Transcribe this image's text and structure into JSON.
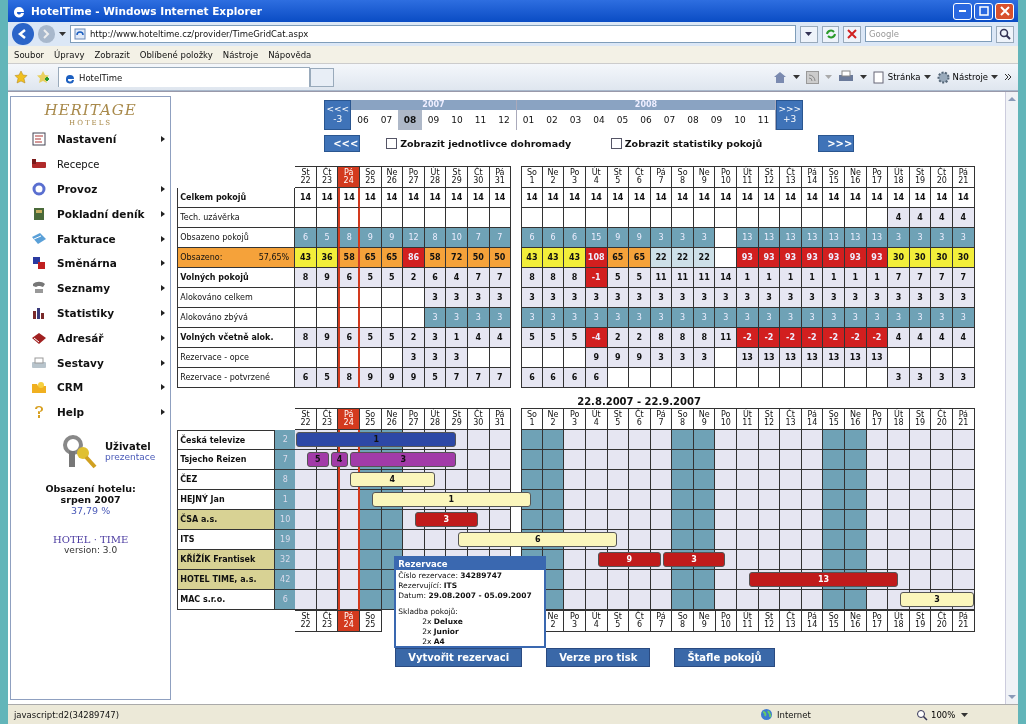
{
  "window": {
    "title": "HotelTime - Windows Internet Explorer"
  },
  "address_bar": {
    "url": "http://www.hoteltime.cz/provider/TimeGridCat.aspx",
    "search_placeholder": "Google"
  },
  "menu": [
    "Soubor",
    "Úpravy",
    "Zobrazit",
    "Oblíbené položky",
    "Nástroje",
    "Nápověda"
  ],
  "tabs": [
    {
      "label": "HotelTime",
      "selected": true
    }
  ],
  "command_bar": [
    "Stránka",
    "Nástroje"
  ],
  "sidebar": {
    "logo": "HERITAGE",
    "logo_sub": "HOTELS",
    "items": [
      {
        "label": "Nastavení",
        "has_submenu": true
      },
      {
        "label": "Recepce",
        "has_submenu": false
      },
      {
        "label": "Provoz",
        "has_submenu": true
      },
      {
        "label": "Pokladní deník",
        "has_submenu": true
      },
      {
        "label": "Fakturace",
        "has_submenu": true
      },
      {
        "label": "Směnárna",
        "has_submenu": true
      },
      {
        "label": "Seznamy",
        "has_submenu": true
      },
      {
        "label": "Statistiky",
        "has_submenu": true
      },
      {
        "label": "Adresář",
        "has_submenu": true
      },
      {
        "label": "Sestavy",
        "has_submenu": true
      },
      {
        "label": "CRM",
        "has_submenu": true
      },
      {
        "label": "Help",
        "has_submenu": true
      }
    ],
    "user": {
      "label": "Uživatel",
      "name": "prezentace"
    },
    "occupancy": {
      "label": "Obsazení hotelu:",
      "period": "srpen 2007",
      "value": "37,79 %"
    },
    "brand": "HOTEL · TIME",
    "version": "version: 3.0"
  },
  "period_nav": {
    "back": "<<<",
    "back_step": "-3",
    "forward": ">>>",
    "forward_step": "+3",
    "years": [
      {
        "label": "2007",
        "months": [
          {
            "label": "06",
            "selected": false
          },
          {
            "label": "07",
            "selected": false
          },
          {
            "label": "08",
            "selected": true
          },
          {
            "label": "09",
            "selected": false
          },
          {
            "label": "10",
            "selected": false
          },
          {
            "label": "11",
            "selected": false
          },
          {
            "label": "12",
            "selected": false
          }
        ]
      },
      {
        "label": "2008",
        "months": [
          {
            "label": "01",
            "selected": false
          },
          {
            "label": "02",
            "selected": false
          },
          {
            "label": "03",
            "selected": false
          },
          {
            "label": "04",
            "selected": false
          },
          {
            "label": "05",
            "selected": false
          },
          {
            "label": "06",
            "selected": false
          },
          {
            "label": "07",
            "selected": false
          },
          {
            "label": "08",
            "selected": false
          },
          {
            "label": "09",
            "selected": false
          },
          {
            "label": "10",
            "selected": false
          },
          {
            "label": "11",
            "selected": false
          }
        ]
      }
    ],
    "prev": "<<<",
    "next": ">>>",
    "options": [
      {
        "label": "Zobrazit jednotlivce dohromady",
        "checked": false
      },
      {
        "label": "Zobrazit statistiky pokojů",
        "checked": false
      }
    ]
  },
  "stats_grid": {
    "days": [
      {
        "weekday": "St",
        "date": "22",
        "selected": false
      },
      {
        "weekday": "Čt",
        "date": "23",
        "selected": false
      },
      {
        "weekday": "Pá",
        "date": "24",
        "selected": true
      },
      {
        "weekday": "So",
        "date": "25",
        "selected": false
      },
      {
        "weekday": "Ne",
        "date": "26",
        "selected": false
      },
      {
        "weekday": "Po",
        "date": "27",
        "selected": false
      },
      {
        "weekday": "Út",
        "date": "28",
        "selected": false
      },
      {
        "weekday": "St",
        "date": "29",
        "selected": false
      },
      {
        "weekday": "Čt",
        "date": "30",
        "selected": false
      },
      {
        "weekday": "Pá",
        "date": "31",
        "selected": false
      },
      {
        "weekday": "So",
        "date": "1",
        "selected": false
      },
      {
        "weekday": "Ne",
        "date": "2",
        "selected": false
      },
      {
        "weekday": "Po",
        "date": "3",
        "selected": false
      },
      {
        "weekday": "Út",
        "date": "4",
        "selected": false
      },
      {
        "weekday": "St",
        "date": "5",
        "selected": false
      },
      {
        "weekday": "Čt",
        "date": "6",
        "selected": false
      },
      {
        "weekday": "Pá",
        "date": "7",
        "selected": false
      },
      {
        "weekday": "So",
        "date": "8",
        "selected": false
      },
      {
        "weekday": "Ne",
        "date": "9",
        "selected": false
      },
      {
        "weekday": "Po",
        "date": "10",
        "selected": false
      },
      {
        "weekday": "Út",
        "date": "11",
        "selected": false
      },
      {
        "weekday": "St",
        "date": "12",
        "selected": false
      },
      {
        "weekday": "Čt",
        "date": "13",
        "selected": false
      },
      {
        "weekday": "Pá",
        "date": "14",
        "selected": false
      },
      {
        "weekday": "So",
        "date": "15",
        "selected": false
      },
      {
        "weekday": "Ne",
        "date": "16",
        "selected": false
      },
      {
        "weekday": "Po",
        "date": "17",
        "selected": false
      },
      {
        "weekday": "Út",
        "date": "18",
        "selected": false
      },
      {
        "weekday": "St",
        "date": "19",
        "selected": false
      },
      {
        "weekday": "Čt",
        "date": "20",
        "selected": false
      },
      {
        "weekday": "Pá",
        "date": "21",
        "selected": false
      }
    ],
    "rows": [
      {
        "label": "Celkem pokojů",
        "bold": true,
        "label_highlighted": false,
        "color": "#ffffff",
        "cells": [
          "14",
          "14",
          "14",
          "14",
          "14",
          "14",
          "14",
          "14",
          "14",
          "14",
          "14",
          "14",
          "14",
          "14",
          "14",
          "14",
          "14",
          "14",
          "14",
          "14",
          "14",
          "14",
          "14",
          "14",
          "14",
          "14",
          "14",
          "14",
          "14",
          "14",
          "14"
        ]
      },
      {
        "label": "Tech. uzávěrka",
        "bold": false,
        "label_highlighted": false,
        "color": "#e6e6f2",
        "cells": [
          null,
          null,
          null,
          null,
          null,
          null,
          null,
          null,
          null,
          null,
          null,
          null,
          null,
          null,
          null,
          null,
          null,
          null,
          null,
          null,
          null,
          null,
          null,
          null,
          null,
          null,
          null,
          "4",
          "4",
          "4",
          "4"
        ]
      },
      {
        "label": "Obsazeno pokojů",
        "bold": false,
        "label_highlighted": false,
        "color": "#6fa2b6",
        "cells": [
          "6",
          "5",
          "8",
          "9",
          "9",
          "12",
          "8",
          "10",
          "7",
          "7",
          "6",
          "6",
          "6",
          "15",
          "9",
          "9",
          "3",
          "3",
          "3",
          null,
          "13",
          "13",
          "13",
          "13",
          "13",
          "13",
          "13",
          "3",
          "3",
          "3",
          "3"
        ]
      },
      {
        "label": "Obsazeno:",
        "value": "57,65%",
        "bold": false,
        "label_highlighted": true,
        "cells": [
          {
            "text": "43",
            "color": "#f2ee3a"
          },
          {
            "text": "36",
            "color": "#f2ee3a"
          },
          {
            "text": "58",
            "color": "#f5a23a"
          },
          {
            "text": "65",
            "color": "#f5a23a"
          },
          {
            "text": "65",
            "color": "#f5a23a"
          },
          {
            "text": "86",
            "color": "#d21f1f"
          },
          {
            "text": "58",
            "color": "#f5a23a"
          },
          {
            "text": "72",
            "color": "#f5a23a"
          },
          {
            "text": "50",
            "color": "#f5a23a"
          },
          {
            "text": "50",
            "color": "#f5a23a"
          },
          {
            "text": "43",
            "color": "#f2ee3a"
          },
          {
            "text": "43",
            "color": "#f2ee3a"
          },
          {
            "text": "43",
            "color": "#f2ee3a"
          },
          {
            "text": "108",
            "color": "#d21f1f"
          },
          {
            "text": "65",
            "color": "#f5a23a"
          },
          {
            "text": "65",
            "color": "#f5a23a"
          },
          {
            "text": "22",
            "color": "#cde0e8"
          },
          {
            "text": "22",
            "color": "#cde0e8"
          },
          {
            "text": "22",
            "color": "#cde0e8"
          },
          null,
          {
            "text": "93",
            "color": "#d21f1f"
          },
          {
            "text": "93",
            "color": "#d21f1f"
          },
          {
            "text": "93",
            "color": "#d21f1f"
          },
          {
            "text": "93",
            "color": "#d21f1f"
          },
          {
            "text": "93",
            "color": "#d21f1f"
          },
          {
            "text": "93",
            "color": "#d21f1f"
          },
          {
            "text": "93",
            "color": "#d21f1f"
          },
          {
            "text": "30",
            "color": "#f2ee3a"
          },
          {
            "text": "30",
            "color": "#f2ee3a"
          },
          {
            "text": "30",
            "color": "#f2ee3a"
          },
          {
            "text": "30",
            "color": "#f2ee3a"
          }
        ]
      },
      {
        "label": "Volných pokojů",
        "bold": true,
        "label_highlighted": false,
        "cells": [
          {
            "text": "8",
            "color": "#e6e6f2"
          },
          {
            "text": "9",
            "color": "#e6e6f2"
          },
          {
            "text": "6",
            "color": "#e6e6f2"
          },
          {
            "text": "5",
            "color": "#e6e6f2"
          },
          {
            "text": "5",
            "color": "#e6e6f2"
          },
          {
            "text": "2",
            "color": "#e6e6f2"
          },
          {
            "text": "6",
            "color": "#e6e6f2"
          },
          {
            "text": "4",
            "color": "#e6e6f2"
          },
          {
            "text": "7",
            "color": "#e6e6f2"
          },
          {
            "text": "7",
            "color": "#e6e6f2"
          },
          {
            "text": "8",
            "color": "#e6e6f2"
          },
          {
            "text": "8",
            "color": "#e6e6f2"
          },
          {
            "text": "8",
            "color": "#e6e6f2"
          },
          {
            "text": "-1",
            "color": "#d21f1f"
          },
          {
            "text": "5",
            "color": "#e6e6f2"
          },
          {
            "text": "5",
            "color": "#e6e6f2"
          },
          {
            "text": "11",
            "color": "#e6e6f2"
          },
          {
            "text": "11",
            "color": "#e6e6f2"
          },
          {
            "text": "11",
            "color": "#e6e6f2"
          },
          {
            "text": "14",
            "color": "#e6e6f2"
          },
          {
            "text": "1",
            "color": "#e6e6f2"
          },
          {
            "text": "1",
            "color": "#e6e6f2"
          },
          {
            "text": "1",
            "color": "#e6e6f2"
          },
          {
            "text": "1",
            "color": "#e6e6f2"
          },
          {
            "text": "1",
            "color": "#e6e6f2"
          },
          {
            "text": "1",
            "color": "#e6e6f2"
          },
          {
            "text": "1",
            "color": "#e6e6f2"
          },
          {
            "text": "7",
            "color": "#e6e6f2"
          },
          {
            "text": "7",
            "color": "#e6e6f2"
          },
          {
            "text": "7",
            "color": "#e6e6f2"
          },
          {
            "text": "7",
            "color": "#e6e6f2"
          }
        ]
      },
      {
        "label": "Alokováno celkem",
        "bold": false,
        "label_highlighted": false,
        "color": "#e6e6f2",
        "cells": [
          null,
          null,
          null,
          null,
          null,
          null,
          "3",
          "3",
          "3",
          "3",
          "3",
          "3",
          "3",
          "3",
          "3",
          "3",
          "3",
          "3",
          "3",
          "3",
          "3",
          "3",
          "3",
          "3",
          "3",
          "3",
          "3",
          "3",
          "3",
          "3",
          "3"
        ]
      },
      {
        "label": "Alokováno zbývá",
        "bold": false,
        "label_highlighted": false,
        "color": "#6fa2b6",
        "cells": [
          null,
          null,
          null,
          null,
          null,
          null,
          "3",
          "3",
          "3",
          "3",
          "3",
          "3",
          "3",
          "3",
          "3",
          "3",
          "3",
          "3",
          "3",
          "3",
          "3",
          "3",
          "3",
          "3",
          "3",
          "3",
          "3",
          "3",
          "3",
          "3",
          "3"
        ]
      },
      {
        "label": "Volných včetně alok.",
        "bold": true,
        "label_highlighted": false,
        "cells": [
          {
            "text": "8",
            "color": "#e6e6f2"
          },
          {
            "text": "9",
            "color": "#e6e6f2"
          },
          {
            "text": "6",
            "color": "#e6e6f2"
          },
          {
            "text": "5",
            "color": "#e6e6f2"
          },
          {
            "text": "5",
            "color": "#e6e6f2"
          },
          {
            "text": "2",
            "color": "#e6e6f2"
          },
          {
            "text": "3",
            "color": "#e6e6f2"
          },
          {
            "text": "1",
            "color": "#e6e6f2"
          },
          {
            "text": "4",
            "color": "#e6e6f2"
          },
          {
            "text": "4",
            "color": "#e6e6f2"
          },
          {
            "text": "5",
            "color": "#e6e6f2"
          },
          {
            "text": "5",
            "color": "#e6e6f2"
          },
          {
            "text": "5",
            "color": "#e6e6f2"
          },
          {
            "text": "-4",
            "color": "#d21f1f"
          },
          {
            "text": "2",
            "color": "#e6e6f2"
          },
          {
            "text": "2",
            "color": "#e6e6f2"
          },
          {
            "text": "8",
            "color": "#e6e6f2"
          },
          {
            "text": "8",
            "color": "#e6e6f2"
          },
          {
            "text": "8",
            "color": "#e6e6f2"
          },
          {
            "text": "11",
            "color": "#e6e6f2"
          },
          {
            "text": "-2",
            "color": "#d21f1f"
          },
          {
            "text": "-2",
            "color": "#d21f1f"
          },
          {
            "text": "-2",
            "color": "#d21f1f"
          },
          {
            "text": "-2",
            "color": "#d21f1f"
          },
          {
            "text": "-2",
            "color": "#d21f1f"
          },
          {
            "text": "-2",
            "color": "#d21f1f"
          },
          {
            "text": "-2",
            "color": "#d21f1f"
          },
          {
            "text": "4",
            "color": "#e6e6f2"
          },
          {
            "text": "4",
            "color": "#e6e6f2"
          },
          {
            "text": "4",
            "color": "#e6e6f2"
          },
          {
            "text": "4",
            "color": "#e6e6f2"
          }
        ]
      },
      {
        "label": "Rezervace - opce",
        "bold": false,
        "label_highlighted": false,
        "color": "#e6e6f2",
        "cells": [
          null,
          null,
          null,
          null,
          null,
          "3",
          "3",
          "3",
          null,
          null,
          null,
          null,
          null,
          "9",
          "9",
          "9",
          "3",
          "3",
          "3",
          null,
          "13",
          "13",
          "13",
          "13",
          "13",
          "13",
          "13",
          null,
          null,
          null,
          null
        ]
      },
      {
        "label": "Rezervace - potvrzené",
        "bold": false,
        "label_highlighted": false,
        "color": "#e6e6f2",
        "cells": [
          "6",
          "5",
          "8",
          "9",
          "9",
          "9",
          "5",
          "7",
          "7",
          "7",
          "6",
          "6",
          "6",
          "6",
          null,
          null,
          null,
          null,
          null,
          null,
          null,
          null,
          null,
          null,
          null,
          null,
          null,
          "3",
          "3",
          "3",
          "3"
        ]
      }
    ]
  },
  "booking_grid": {
    "range": "22.8.2007 - 22.9.2007",
    "days": [
      {
        "weekday": "St",
        "date": "22",
        "selected": false,
        "weekend": false
      },
      {
        "weekday": "Čt",
        "date": "23",
        "selected": false,
        "weekend": false
      },
      {
        "weekday": "Pá",
        "date": "24",
        "selected": true,
        "weekend": false
      },
      {
        "weekday": "So",
        "date": "25",
        "selected": false,
        "weekend": true
      },
      {
        "weekday": "Ne",
        "date": "26",
        "selected": false,
        "weekend": true
      },
      {
        "weekday": "Po",
        "date": "27",
        "selected": false,
        "weekend": false
      },
      {
        "weekday": "Út",
        "date": "28",
        "selected": false,
        "weekend": false
      },
      {
        "weekday": "St",
        "date": "29",
        "selected": false,
        "weekend": false
      },
      {
        "weekday": "Čt",
        "date": "30",
        "selected": false,
        "weekend": false
      },
      {
        "weekday": "Pá",
        "date": "31",
        "selected": false,
        "weekend": false
      },
      {
        "weekday": "So",
        "date": "1",
        "selected": false,
        "weekend": true
      },
      {
        "weekday": "Ne",
        "date": "2",
        "selected": false,
        "weekend": true
      },
      {
        "weekday": "Po",
        "date": "3",
        "selected": false,
        "weekend": false
      },
      {
        "weekday": "Út",
        "date": "4",
        "selected": false,
        "weekend": false
      },
      {
        "weekday": "St",
        "date": "5",
        "selected": false,
        "weekend": false
      },
      {
        "weekday": "Čt",
        "date": "6",
        "selected": false,
        "weekend": false
      },
      {
        "weekday": "Pá",
        "date": "7",
        "selected": false,
        "weekend": false
      },
      {
        "weekday": "So",
        "date": "8",
        "selected": false,
        "weekend": true
      },
      {
        "weekday": "Ne",
        "date": "9",
        "selected": false,
        "weekend": true
      },
      {
        "weekday": "Po",
        "date": "10",
        "selected": false,
        "weekend": false
      },
      {
        "weekday": "Út",
        "date": "11",
        "selected": false,
        "weekend": false
      },
      {
        "weekday": "St",
        "date": "12",
        "selected": false,
        "weekend": false
      },
      {
        "weekday": "Čt",
        "date": "13",
        "selected": false,
        "weekend": false
      },
      {
        "weekday": "Pá",
        "date": "14",
        "selected": false,
        "weekend": false
      },
      {
        "weekday": "So",
        "date": "15",
        "selected": false,
        "weekend": true
      },
      {
        "weekday": "Ne",
        "date": "16",
        "selected": false,
        "weekend": true
      },
      {
        "weekday": "Po",
        "date": "17",
        "selected": false,
        "weekend": false
      },
      {
        "weekday": "Út",
        "date": "18",
        "selected": false,
        "weekend": false
      },
      {
        "weekday": "St",
        "date": "19",
        "selected": false,
        "weekend": false
      },
      {
        "weekday": "Čt",
        "date": "20",
        "selected": false,
        "weekend": false
      },
      {
        "weekday": "Pá",
        "date": "21",
        "selected": false,
        "weekend": false
      }
    ],
    "rows": [
      {
        "name": "Česká televize",
        "rooms": "2",
        "highlighted": false,
        "bars": [
          {
            "label": "1",
            "color": "#2d48a6"
          }
        ]
      },
      {
        "name": "Tsjecho Reizen",
        "rooms": "7",
        "highlighted": false,
        "bars": [
          {
            "label": "5",
            "color": "#a23ba8"
          },
          {
            "label": "4",
            "color": "#a23ba8"
          },
          {
            "label": "3",
            "color": "#a23ba8"
          }
        ]
      },
      {
        "name": "ČEZ",
        "rooms": "8",
        "highlighted": false,
        "bars": [
          {
            "label": "4",
            "color": "#fbf6bc"
          }
        ]
      },
      {
        "name": "HEJNÝ Jan",
        "rooms": "1",
        "highlighted": false,
        "bars": [
          {
            "label": "1",
            "color": "#fbf6bc"
          }
        ]
      },
      {
        "name": "ČSA a.s.",
        "rooms": "10",
        "highlighted": true,
        "bars": [
          {
            "label": "3",
            "color": "#c01b1b"
          }
        ]
      },
      {
        "name": "ITS",
        "rooms": "19",
        "highlighted": false,
        "bars": [
          {
            "label": "6",
            "color": "#fbf6bc"
          }
        ]
      },
      {
        "name": "KŘÍŽÍK Frantisek",
        "rooms": "32",
        "highlighted": true,
        "bars": [
          {
            "label": "9",
            "color": "#c01b1b"
          },
          {
            "label": "3",
            "color": "#c01b1b"
          }
        ]
      },
      {
        "name": "HOTEL TIME, a.s.",
        "rooms": "42",
        "highlighted": true,
        "bars": [
          {
            "label": "13",
            "color": "#c01b1b"
          }
        ]
      },
      {
        "name": "MAC s.r.o.",
        "rooms": "6",
        "highlighted": false,
        "bars": [
          {
            "label": "3",
            "color": "#fbf6bc"
          }
        ]
      }
    ],
    "footer_days_left": [
      {
        "weekday": "St",
        "date": "22",
        "selected": false
      },
      {
        "weekday": "Čt",
        "date": "23",
        "selected": false
      },
      {
        "weekday": "Pá",
        "date": "24",
        "selected": true
      },
      {
        "weekday": "So",
        "date": "25",
        "selected": false
      }
    ],
    "footer_days_right": [
      {
        "weekday": "Ne",
        "date": "2",
        "selected": false
      },
      {
        "weekday": "Po",
        "date": "3",
        "selected": false
      },
      {
        "weekday": "Út",
        "date": "4",
        "selected": false
      },
      {
        "weekday": "St",
        "date": "5",
        "selected": false
      },
      {
        "weekday": "Čt",
        "date": "6",
        "selected": false
      },
      {
        "weekday": "Pá",
        "date": "7",
        "selected": false
      },
      {
        "weekday": "So",
        "date": "8",
        "selected": false
      },
      {
        "weekday": "Ne",
        "date": "9",
        "selected": false
      },
      {
        "weekday": "Po",
        "date": "10",
        "selected": false
      },
      {
        "weekday": "Út",
        "date": "11",
        "selected": false
      },
      {
        "weekday": "St",
        "date": "12",
        "selected": false
      },
      {
        "weekday": "Čt",
        "date": "13",
        "selected": false
      },
      {
        "weekday": "Pá",
        "date": "14",
        "selected": false
      },
      {
        "weekday": "So",
        "date": "15",
        "selected": false
      },
      {
        "weekday": "Ne",
        "date": "16",
        "selected": false
      },
      {
        "weekday": "Po",
        "date": "17",
        "selected": false
      },
      {
        "weekday": "Út",
        "date": "18",
        "selected": false
      },
      {
        "weekday": "St",
        "date": "19",
        "selected": false
      },
      {
        "weekday": "Čt",
        "date": "20",
        "selected": false
      },
      {
        "weekday": "Pá",
        "date": "21",
        "selected": false
      }
    ]
  },
  "tooltip": {
    "title": "Rezervace",
    "fields": [
      {
        "label": "Číslo rezervace:",
        "value": "34289747"
      },
      {
        "label": "Rezervující:",
        "value": "ITS"
      },
      {
        "label": "Datum:",
        "value": "29.08.2007 - 05.09.2007"
      }
    ],
    "rooms_heading": "Skladba pokojů:",
    "rooms": [
      {
        "count": "2x",
        "type": "Deluxe"
      },
      {
        "count": "2x",
        "type": "Junior"
      },
      {
        "count": "2x",
        "type": "A4"
      }
    ]
  },
  "buttons": [
    "Vytvořit rezervaci",
    "Verze pro tisk",
    "Štafle pokojů"
  ],
  "status_bar": {
    "text": "javascript:d2(34289747)",
    "zone": "Internet",
    "zoom": "100%"
  }
}
